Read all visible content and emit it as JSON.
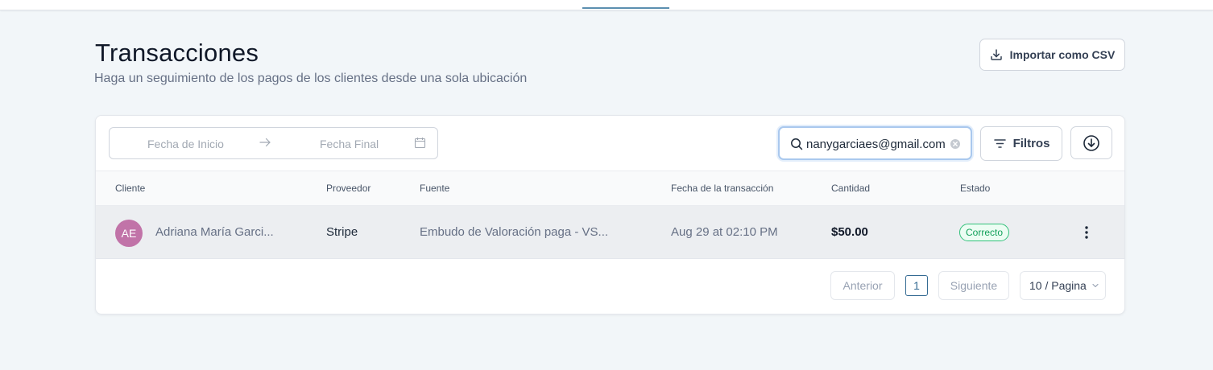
{
  "header": {
    "title": "Transacciones",
    "subtitle": "Haga un seguimiento de los pagos de los clientes desde una sola ubicación",
    "import_label": "Importar como CSV"
  },
  "toolbar": {
    "date_start_placeholder": "Fecha de Inicio",
    "date_end_placeholder": "Fecha Final",
    "search_value": "nanygarciaes@gmail.com",
    "filters_label": "Filtros"
  },
  "table": {
    "columns": [
      "Cliente",
      "Proveedor",
      "Fuente",
      "Fecha de la transacción",
      "Cantidad",
      "Estado"
    ],
    "rows": [
      {
        "initials": "AE",
        "client": "Adriana María Garci...",
        "provider": "Stripe",
        "source": "Embudo de Valoración paga - VS...",
        "date": "Aug 29 at 02:10 PM",
        "amount": "$50.00",
        "status": "Correcto"
      }
    ]
  },
  "pagination": {
    "prev_label": "Anterior",
    "current_page": "1",
    "next_label": "Siguiente",
    "page_size_label": "10 / Pagina"
  },
  "colors": {
    "accent": "#356b93",
    "avatar": "#c173a8",
    "status_success": "#12a05a"
  },
  "icons": [
    "download-icon",
    "arrow-right-icon",
    "calendar-icon",
    "search-icon",
    "clear-icon",
    "filter-icon",
    "download-circle-icon",
    "more-vertical-icon",
    "chevron-down-icon"
  ]
}
